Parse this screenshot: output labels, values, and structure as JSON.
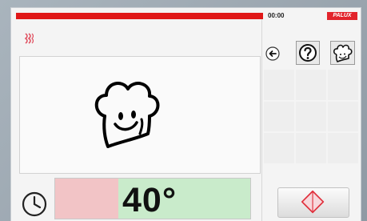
{
  "status_bar": {
    "time": "00:00",
    "brand": "PALUX",
    "progress_color": "#e01818"
  },
  "display": {
    "program_icon": "chef-hat-smiley-icon"
  },
  "temperature": {
    "value": "40°",
    "actual_color": "#f2c4c6",
    "target_color": "#c9ebcb"
  },
  "icons": {
    "timer": "clock-icon",
    "back": "back-arrow-icon",
    "help": "question-mark-icon",
    "chef": "chef-hat-icon",
    "start": "start-diamond-icon",
    "mini": "steam-icon"
  },
  "grid": {
    "cells": 9
  }
}
